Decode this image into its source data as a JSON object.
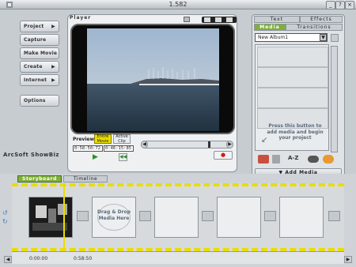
{
  "window": {
    "title": "1.582"
  },
  "menu": {
    "items": [
      {
        "label": "Project"
      },
      {
        "label": "Capture"
      },
      {
        "label": "Make Movie"
      },
      {
        "label": "Create"
      },
      {
        "label": "Internet"
      }
    ],
    "options_label": "Options",
    "brand": "ArcSoft ShowBiz"
  },
  "player": {
    "label": "Player",
    "preview_label": "Preview:",
    "mode_entire": "Entire Movie",
    "mode_active": "Active Clip",
    "time_current": "0:58:50:72",
    "time_total": "0:46:15:85"
  },
  "right_panel": {
    "tabs_top": [
      "Text",
      "Effects"
    ],
    "tabs_bottom": [
      "Media",
      "Transitions"
    ],
    "album": "New Album1",
    "hint": "Press this button to add media and begin your project",
    "add_media_label": "Add Media"
  },
  "storyboard": {
    "tab_storyboard": "Storyboard",
    "tab_timeline": "Timeline",
    "drop_hint": "Drag & Drop Media Here",
    "time_start": "0:00:00",
    "time_marker": "0:58:50"
  },
  "colors": {
    "accent_green": "#7fb03a",
    "film_dashes": "#e9dd00",
    "hint_text": "#5b6a7a"
  }
}
